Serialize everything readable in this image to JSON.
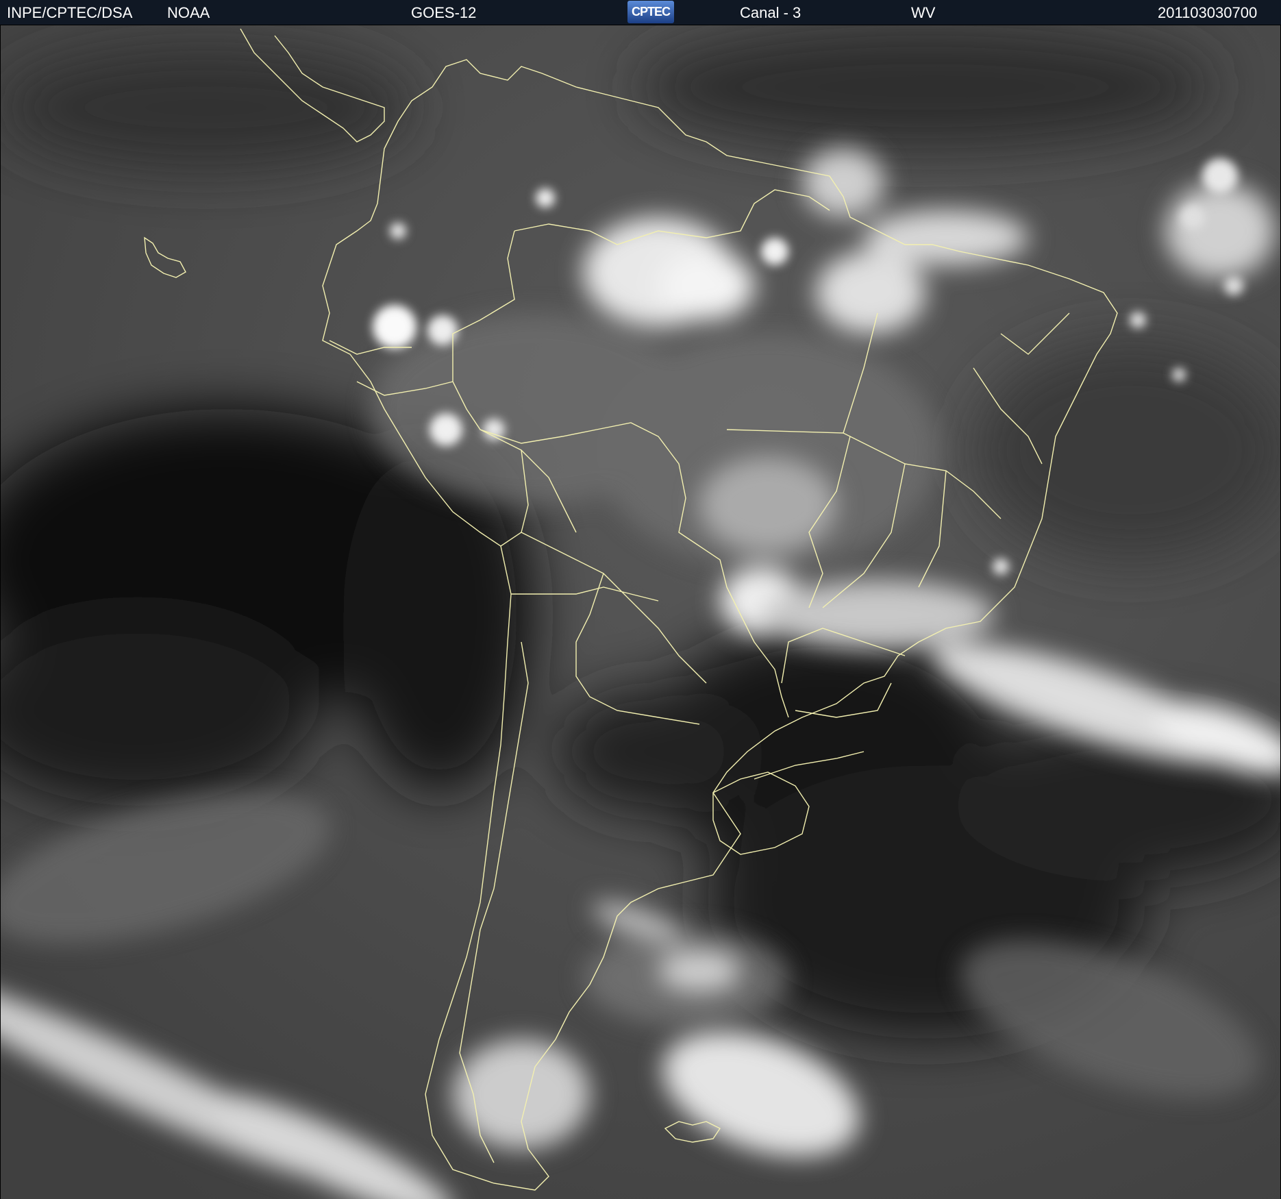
{
  "header": {
    "agency": "INPE/CPTEC/DSA",
    "source": "NOAA",
    "satellite": "GOES-12",
    "logo_text": "CPTEC",
    "channel": "Canal - 3",
    "product": "WV",
    "timestamp": "201103030700"
  },
  "colors": {
    "header_background": "#101824",
    "header_text": "#ffffff",
    "boundary_lines": "#f3f0b0",
    "dry_air": "#111111",
    "clouds": "#f2f2f2"
  }
}
